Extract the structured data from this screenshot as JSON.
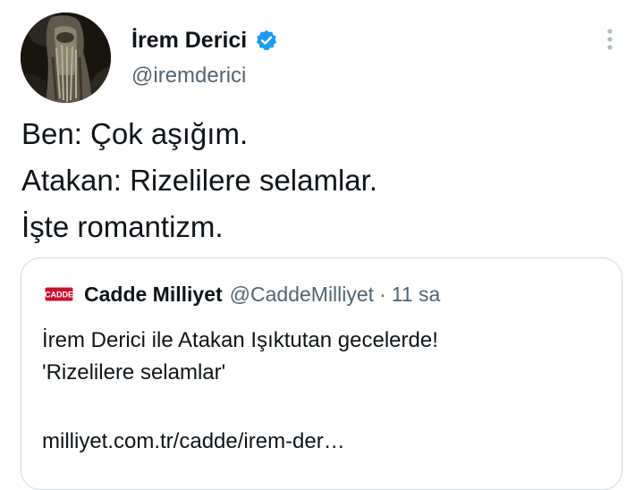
{
  "author": {
    "display_name": "İrem Derici",
    "handle": "@iremderici",
    "verified": true,
    "avatar": "avatar-photo",
    "verified_color": "#1d9bf0"
  },
  "menu": {
    "icon": "more-vertical-icon"
  },
  "tweet": {
    "lines": [
      "Ben: Çok aşığım.",
      "Atakan: Rizelilere selamlar.",
      "İşte romantizm."
    ]
  },
  "quote": {
    "logo_text": "CADDE",
    "logo_color": "#c8102e",
    "display_name": "Cadde Milliyet",
    "handle": "@CaddeMilliyet",
    "separator": "·",
    "time": "11 sa",
    "text_lines": [
      "İrem Derici ile Atakan Işıktutan gecelerde!",
      "'Rizelilere selamlar'"
    ],
    "link": "milliyet.com.tr/cadde/irem-der…"
  },
  "colors": {
    "text": "#0f1419",
    "secondary": "#536471",
    "border": "#cfd9de"
  }
}
